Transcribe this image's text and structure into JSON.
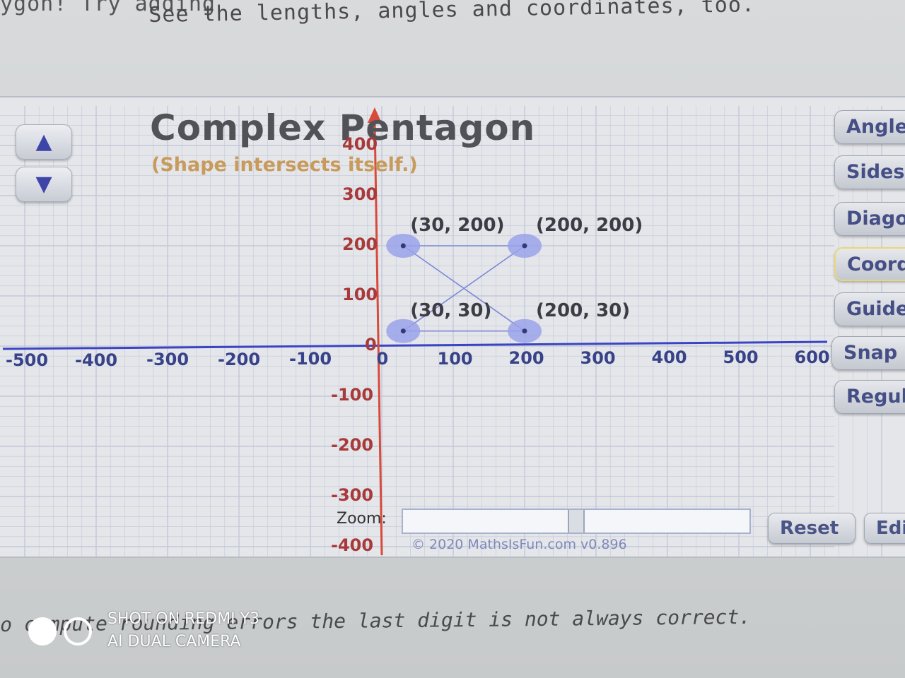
{
  "page": {
    "cut_top_text": "ygon!  Try adding",
    "intro_text": "See the lengths, angles and coordinates, too.",
    "bottom_text": "o compute rounding errors the last digit is not always correct."
  },
  "app": {
    "shape_title": "Complex Pentagon",
    "shape_subtitle": "(Shape intersects itself.)",
    "step_up_icon": "triangle-up-icon",
    "step_down_icon": "triangle-down-icon",
    "side_buttons": [
      "Angles",
      "Sides",
      "Diagonals",
      "Coordinates",
      "Guides",
      "Snap",
      "Regular"
    ],
    "active_side_button": "Coordinates",
    "zoom_label": "Zoom:",
    "zoom_level": 0.5,
    "copyright": "© 2020 MathsIsFun.com v0.896",
    "reset_label": "Reset",
    "edit_label": "Edit"
  },
  "graph": {
    "x_ticks": [
      "-500",
      "-400",
      "-300",
      "-200",
      "-100",
      "0",
      "100",
      "200",
      "300",
      "400",
      "500",
      "600"
    ],
    "y_ticks": [
      "400",
      "300",
      "200",
      "100",
      "0",
      "-100",
      "-200",
      "-300",
      "-400"
    ],
    "vertices": [
      {
        "x": 30,
        "y": 200,
        "label": "(30, 200)"
      },
      {
        "x": 200,
        "y": 200,
        "label": "(200, 200)"
      },
      {
        "x": 30,
        "y": 30,
        "label": "(30, 30)"
      },
      {
        "x": 200,
        "y": 30,
        "label": "(200, 30)"
      }
    ],
    "edges": [
      [
        0,
        1
      ],
      [
        1,
        2
      ],
      [
        2,
        3
      ],
      [
        3,
        0
      ]
    ],
    "colors": {
      "x_axis": "#3b44c4",
      "y_axis": "#d84a3a",
      "grid": "#c3c8d8",
      "edge": "#8088d8",
      "vertex_halo": "#9aa2ea",
      "vertex_dot": "#333a7a"
    }
  },
  "watermark": {
    "line1": "SHOT ON REDMI Y3",
    "line2": "AI DUAL CAMERA"
  }
}
